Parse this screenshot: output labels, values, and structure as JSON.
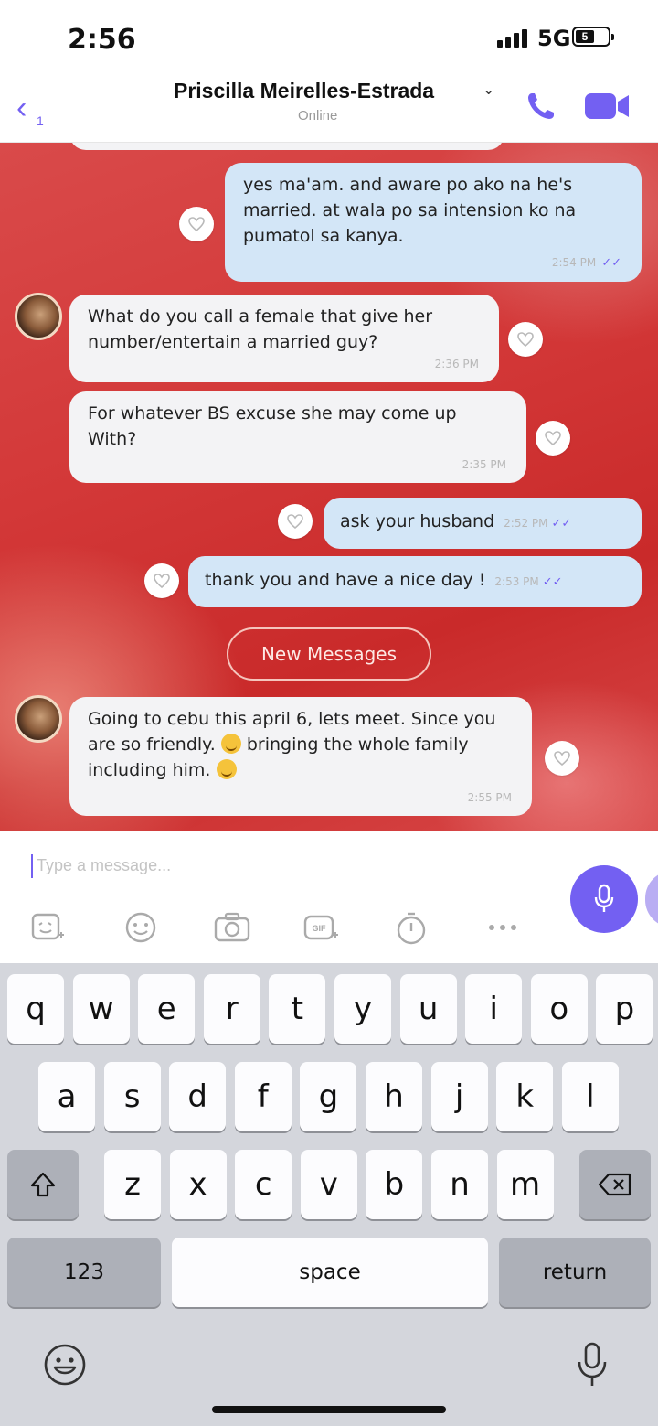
{
  "status_bar": {
    "time": "2:56",
    "network": "5G",
    "battery": "5"
  },
  "header": {
    "back_count": "1",
    "contact_name": "Priscilla Meirelles-Estrada",
    "presence": "Online"
  },
  "messages": [
    {
      "direction": "out",
      "text": "yes ma'am. and aware po ako na he's married. at wala po sa intension ko na pumatol sa kanya.",
      "time": "2:54 PM",
      "ticks": "✓✓"
    },
    {
      "direction": "in",
      "text": "What do you call a female that give her number/entertain a married guy?",
      "time": "2:36 PM"
    },
    {
      "direction": "in",
      "text": "For whatever BS excuse she may come up With?",
      "time": "2:35 PM"
    },
    {
      "direction": "out",
      "text": "ask your husband",
      "time": "2:52 PM",
      "ticks": "✓✓"
    },
    {
      "direction": "out",
      "text": "thank you and have a nice day !",
      "time": "2:53 PM",
      "ticks": "✓✓"
    },
    {
      "direction": "in",
      "text_part1": "Going to cebu this april 6, lets meet. Since you are so friendly.",
      "text_part2": "bringing the whole family including him.",
      "time": "2:55 PM"
    }
  ],
  "new_messages_label": "New Messages",
  "composer": {
    "placeholder": "Type a message..."
  },
  "keyboard": {
    "row1": [
      "q",
      "w",
      "e",
      "r",
      "t",
      "y",
      "u",
      "i",
      "o",
      "p"
    ],
    "row2": [
      "a",
      "s",
      "d",
      "f",
      "g",
      "h",
      "j",
      "k",
      "l"
    ],
    "row3": [
      "z",
      "x",
      "c",
      "v",
      "b",
      "n",
      "m"
    ],
    "numbers_label": "123",
    "space_label": "space",
    "return_label": "return"
  },
  "colors": {
    "accent": "#7360f2",
    "outgoing_bubble": "#d3e6f7",
    "incoming_bubble": "#f3f3f5",
    "chat_background": "#d33838"
  }
}
